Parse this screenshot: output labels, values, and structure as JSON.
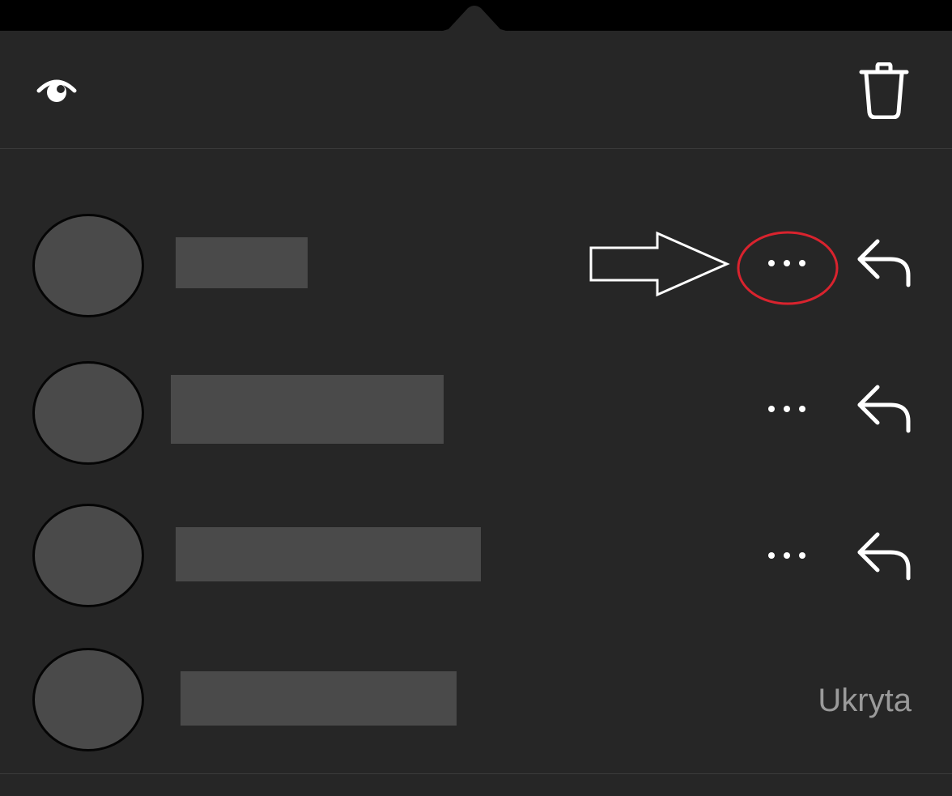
{
  "toolbar": {
    "visibility_icon": "eye-icon",
    "delete_icon": "trash-icon"
  },
  "messages": [
    {
      "more_icon": "ellipsis-icon",
      "reply_icon": "reply-icon",
      "status": ""
    },
    {
      "more_icon": "ellipsis-icon",
      "reply_icon": "reply-icon",
      "status": ""
    },
    {
      "more_icon": "ellipsis-icon",
      "reply_icon": "reply-icon",
      "status": ""
    },
    {
      "more_icon": "",
      "reply_icon": "",
      "status": "Ukryta"
    }
  ],
  "annotation": {
    "arrow_icon": "arrow-right-icon",
    "highlight_color": "#d9232e"
  },
  "colors": {
    "background": "#262626",
    "placeholder": "#4a4a4a",
    "icon": "#ffffff",
    "status_text": "#9a9a9a"
  }
}
